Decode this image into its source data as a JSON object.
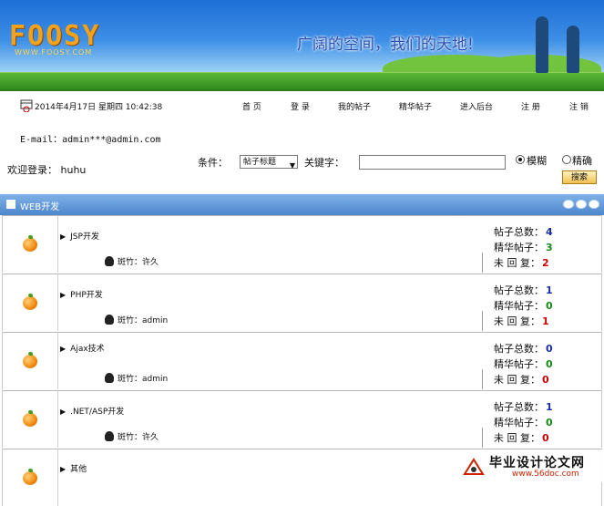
{
  "banner": {
    "logo": "FOOSY",
    "logo_sub": "WWW.FOOSY.COM",
    "slogan": "广阔的空间，我们的天地!"
  },
  "topbar": {
    "datetime": "2014年4月17日 星期四  10:42:38",
    "nav": [
      "首 页",
      "登 录",
      "我的帖子",
      "精华帖子",
      "进入后台",
      "注 册",
      "注 销"
    ]
  },
  "email": "E-mail：admin***@admin.com",
  "welcome": "欢迎登录：  huhu",
  "search": {
    "condition_label": "条件：",
    "condition_value": "帖子标题",
    "keyword_label": "关键字：",
    "keyword_value": "",
    "radio_fuzzy": "模糊",
    "radio_exact": "精确",
    "button": "搜索"
  },
  "section": {
    "title": "WEB开发"
  },
  "forums": [
    {
      "name": "JSP开发",
      "moderator": "斑竹：许久",
      "total_label": "帖子总数：",
      "total": "4",
      "best_label": "精华帖子：",
      "best": "3",
      "noreply_label": "未 回 复：",
      "noreply": "2"
    },
    {
      "name": "PHP开发",
      "moderator": "斑竹：admin",
      "total_label": "帖子总数：",
      "total": "1",
      "best_label": "精华帖子：",
      "best": "0",
      "noreply_label": "未 回 复：",
      "noreply": "1"
    },
    {
      "name": "Ajax技术",
      "moderator": "斑竹：admin",
      "total_label": "帖子总数：",
      "total": "0",
      "best_label": "精华帖子：",
      "best": "0",
      "noreply_label": "未 回 复：",
      "noreply": "0"
    },
    {
      "name": ".NET/ASP开发",
      "moderator": "斑竹：许久",
      "total_label": "帖子总数：",
      "total": "1",
      "best_label": "精华帖子：",
      "best": "0",
      "noreply_label": "未 回 复：",
      "noreply": "0"
    },
    {
      "name": "其他",
      "moderator": "",
      "total_label": "",
      "total": "",
      "best_label": "",
      "best": "",
      "noreply_label": "",
      "noreply": ""
    }
  ],
  "watermark": {
    "text": "毕业设计论文网",
    "url": "www.56doc.com"
  }
}
